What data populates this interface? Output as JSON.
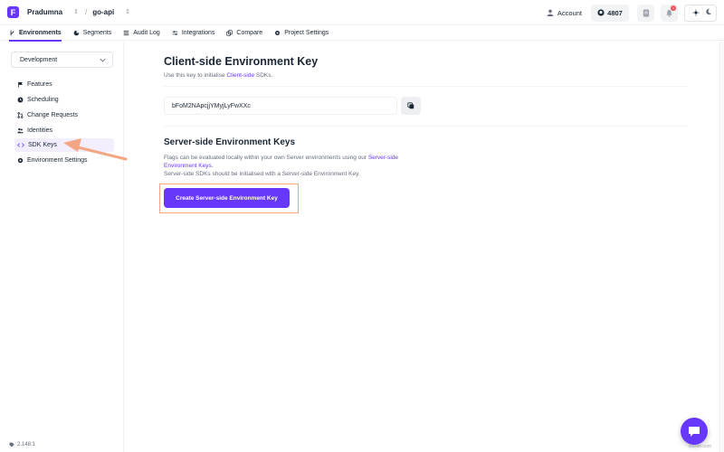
{
  "topbar": {
    "logo_letter": "F",
    "org_name": "Pradumna",
    "project_name": "go-api",
    "separator": "/",
    "account_label": "Account",
    "github_stars": "4807",
    "notification_count": "1"
  },
  "nav": {
    "tabs": [
      {
        "label": "Environments",
        "icon": "branch-icon",
        "active": true
      },
      {
        "label": "Segments",
        "icon": "segments-icon",
        "active": false
      },
      {
        "label": "Audit Log",
        "icon": "list-icon",
        "active": false
      },
      {
        "label": "Integrations",
        "icon": "sliders-icon",
        "active": false
      },
      {
        "label": "Compare",
        "icon": "copy-icon",
        "active": false
      },
      {
        "label": "Project Settings",
        "icon": "gear-icon",
        "active": false
      }
    ]
  },
  "sidebar": {
    "environment_selected": "Development",
    "items": [
      {
        "label": "Features",
        "icon": "flag-icon"
      },
      {
        "label": "Scheduling",
        "icon": "clock-icon"
      },
      {
        "label": "Change Requests",
        "icon": "change-request-icon"
      },
      {
        "label": "Identities",
        "icon": "people-icon"
      },
      {
        "label": "SDK Keys",
        "icon": "code-icon",
        "active": true
      },
      {
        "label": "Environment Settings",
        "icon": "gear-icon"
      }
    ],
    "version": "2.148.1"
  },
  "main": {
    "client_title": "Client-side Environment Key",
    "client_sub_pre": "Use this key to initialise ",
    "client_sub_link": "Client-side",
    "client_sub_post": " SDKs.",
    "client_key": "bFoM2NApcjjYMyjLyFwXXc",
    "server_title": "Server-side Environment Keys",
    "server_para_pre": "Flags can be evaluated locally within your own Server environments using our ",
    "server_para_link": "Server-side Environment Keys",
    "server_para_post": ".",
    "server_para_line2": "Server-side SDKs should be initialised with a Server-side Environment Key.",
    "create_button": "Create Server-side Environment Key"
  },
  "colors": {
    "accent": "#6837fc",
    "annotation": "#f4a684"
  },
  "watermark": "wsxdn.com"
}
